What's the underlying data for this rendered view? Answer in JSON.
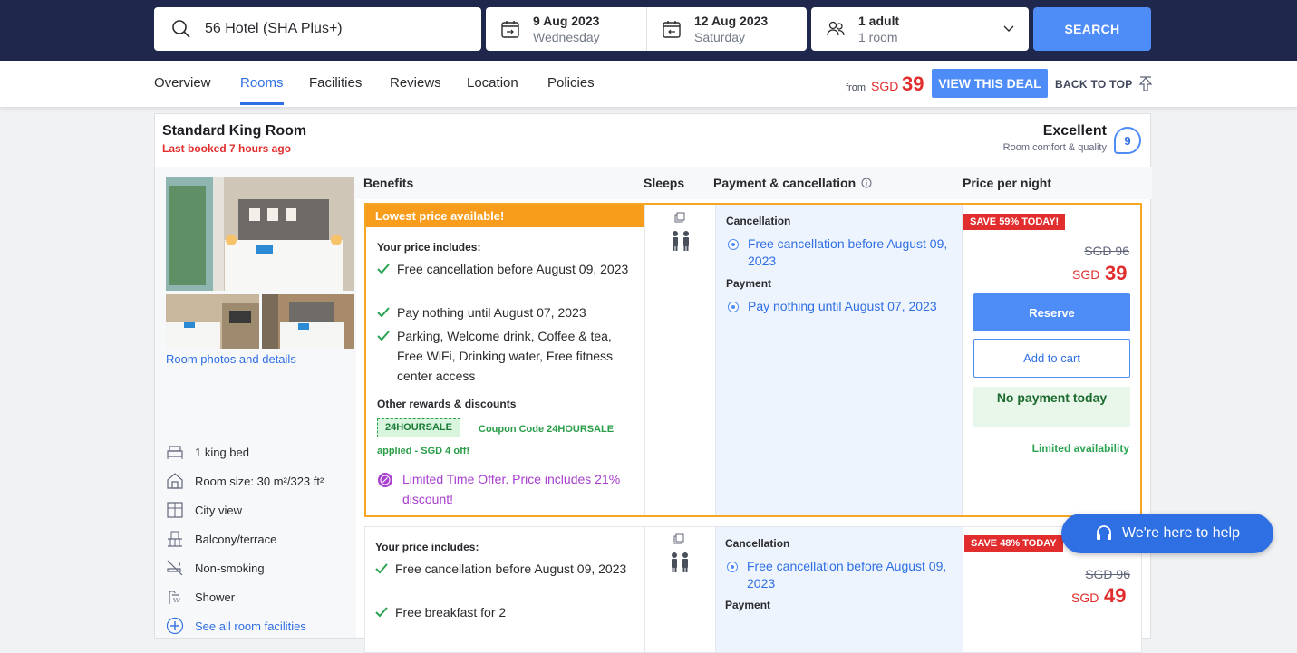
{
  "search": {
    "query": "56 Hotel (SHA Plus+)",
    "checkin_date": "9 Aug 2023",
    "checkin_day": "Wednesday",
    "checkout_date": "12 Aug 2023",
    "checkout_day": "Saturday",
    "guests": "1 adult",
    "rooms": "1 room",
    "button": "SEARCH"
  },
  "nav": {
    "tabs": [
      "Overview",
      "Rooms",
      "Facilities",
      "Reviews",
      "Location",
      "Policies"
    ],
    "active_tab": "Rooms",
    "from_label": "from",
    "from_currency": "SGD",
    "from_amount": "39",
    "deal_button": "VIEW THIS DEAL",
    "back_to_top": "BACK TO TOP"
  },
  "room": {
    "name": "Standard King Room",
    "last_booked": "Last booked 7 hours ago",
    "rating_word": "Excellent",
    "rating_sub": "Room comfort & quality",
    "rating_score": "9",
    "photos_link": "Room photos and details",
    "features": [
      {
        "label": "1 king bed",
        "icon": "bed-icon"
      },
      {
        "label": "Room size: 30 m²/323 ft²",
        "icon": "house-icon"
      },
      {
        "label": "City view",
        "icon": "window-icon"
      },
      {
        "label": "Balcony/terrace",
        "icon": "balcony-icon"
      },
      {
        "label": "Non-smoking",
        "icon": "no-smoking-icon"
      },
      {
        "label": "Shower",
        "icon": "shower-icon"
      }
    ],
    "all_facilities": "See all room facilities"
  },
  "headers": {
    "benefits": "Benefits",
    "sleeps": "Sleeps",
    "payment": "Payment & cancellation",
    "price": "Price per night"
  },
  "offer1": {
    "banner": "Lowest price available!",
    "includes_title": "Your price includes:",
    "benefit1": "Free cancellation before August 09, 2023",
    "benefit2": "Pay nothing until August 07, 2023",
    "benefit3": "Parking, Welcome drink, Coffee & tea, Free WiFi, Drinking water, Free fitness center access",
    "rewards_title": "Other rewards & discounts",
    "coupon_code": "24HOURSALE",
    "coupon_text": "Coupon Code 24HOURSALE applied - SGD 4 off!",
    "promo": "Limited Time Offer. Price includes 21% discount!",
    "cancel_title": "Cancellation",
    "cancel_text": "Free cancellation before August 09, 2023",
    "payment_title": "Payment",
    "payment_text": "Pay nothing until August 07, 2023",
    "save_tag": "SAVE 59% TODAY!",
    "old_price": "SGD 96",
    "currency": "SGD",
    "price": "39",
    "reserve": "Reserve",
    "add_to_cart": "Add to cart",
    "no_payment": "No payment today",
    "availability": "Limited availability"
  },
  "offer2": {
    "includes_title": "Your price includes:",
    "benefit1": "Free cancellation before August 09, 2023",
    "benefit2": "Free breakfast for 2",
    "cancel_title": "Cancellation",
    "cancel_text": "Free cancellation before August 09, 2023",
    "payment_title": "Payment",
    "save_tag": "SAVE 48% TODAY",
    "old_price": "SGD 96",
    "currency": "SGD",
    "price": "49"
  },
  "help": "We're here to help",
  "colors": {
    "topbar": "#20274d",
    "accent": "#4e8cf7",
    "price_red": "#e12d2d",
    "offer_border": "#f5a623",
    "promo_purple": "#a83fcf",
    "green": "#2aa452"
  }
}
